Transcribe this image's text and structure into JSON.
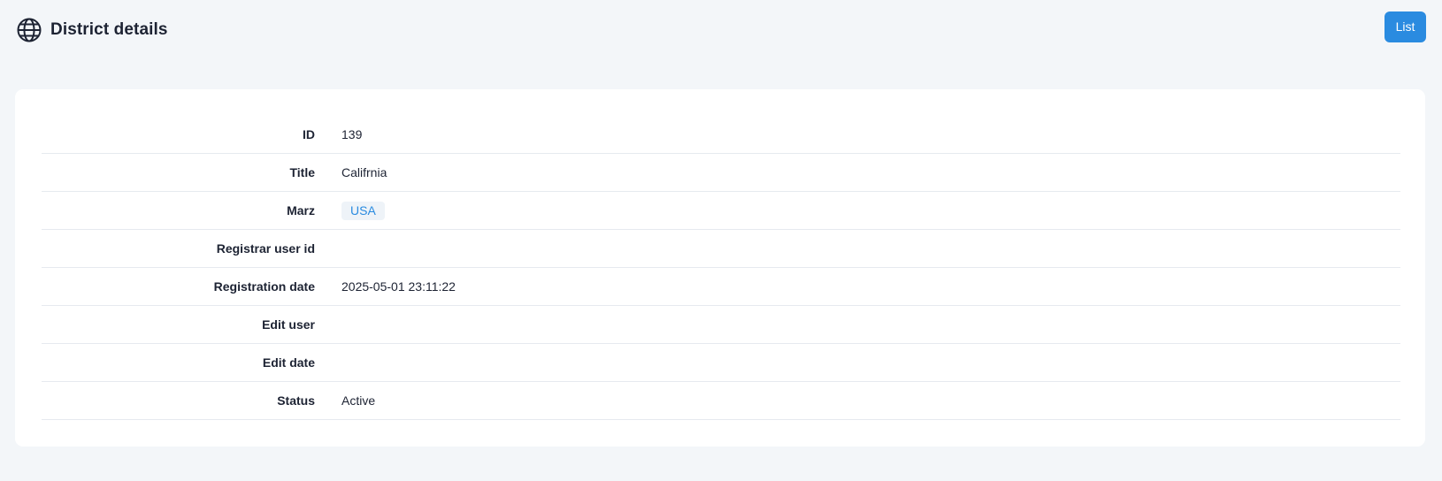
{
  "header": {
    "icon": "globe-icon",
    "title": "District details",
    "list_button_label": "List",
    "accent_color": "#2a8be0"
  },
  "details": {
    "id": {
      "label": "ID",
      "value": "139"
    },
    "title": {
      "label": "Title",
      "value": "Califrnia"
    },
    "marz": {
      "label": "Marz",
      "value": "USA"
    },
    "registrar_user_id": {
      "label": "Registrar user id",
      "value": ""
    },
    "registration_date": {
      "label": "Registration date",
      "value": "2025-05-01 23:11:22"
    },
    "edit_user": {
      "label": "Edit user",
      "value": ""
    },
    "edit_date": {
      "label": "Edit date",
      "value": ""
    },
    "status": {
      "label": "Status",
      "value": "Active"
    }
  }
}
